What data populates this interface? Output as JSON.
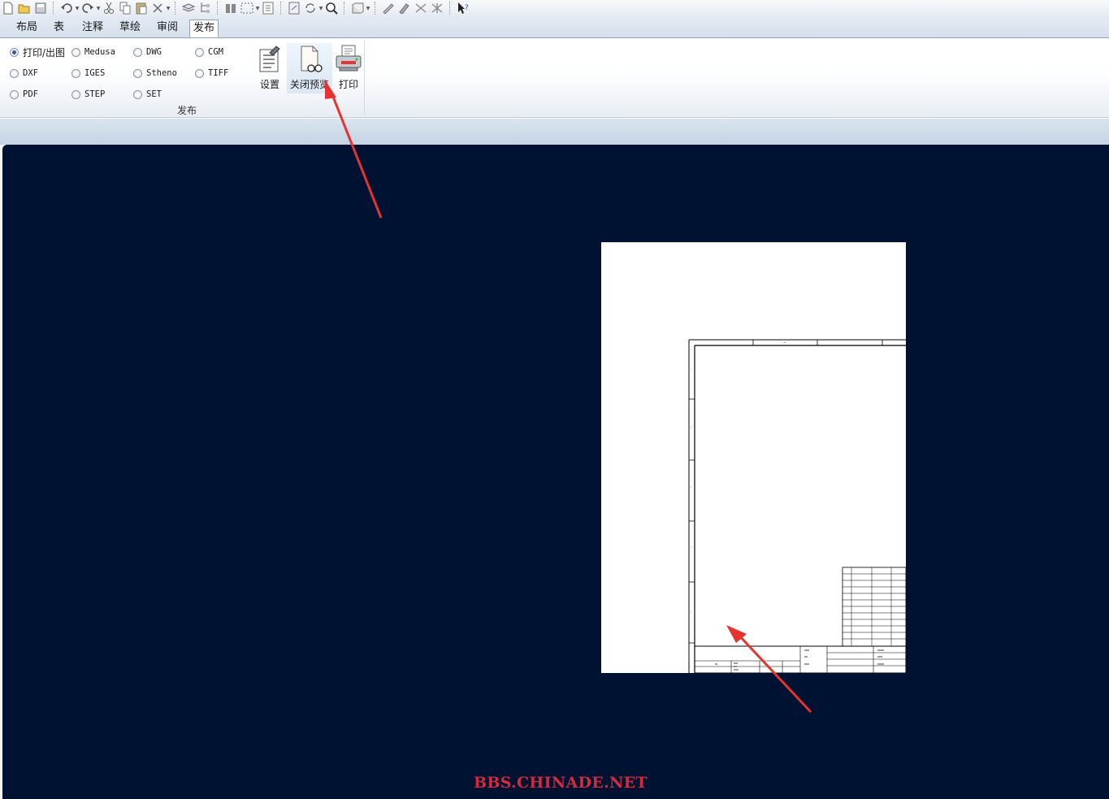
{
  "tabs": [
    {
      "label": "布局",
      "active": false
    },
    {
      "label": "表",
      "active": false
    },
    {
      "label": "注释",
      "active": false
    },
    {
      "label": "草绘",
      "active": false
    },
    {
      "label": "审阅",
      "active": false
    },
    {
      "label": "发布",
      "active": true
    }
  ],
  "quick_access_icons": [
    "new-file-icon",
    "open-folder-icon",
    "save-icon",
    "undo-icon",
    "redo-icon",
    "cut-icon",
    "copy-icon",
    "paste-icon",
    "delete-icon",
    "layers-icon",
    "tree-icon",
    "find-icon",
    "select-box-icon",
    "properties-icon",
    "regenerate-icon",
    "refresh-icon",
    "zoom-icon",
    "display-style-icon",
    "sketch-tool-icon",
    "pencil-tool-icon",
    "erase-tool-icon",
    "erase-all-icon",
    "context-help-icon"
  ],
  "publish": {
    "formats": [
      {
        "label": "打印/出图",
        "selected": true
      },
      {
        "label": "Medusa",
        "selected": false
      },
      {
        "label": "DWG",
        "selected": false
      },
      {
        "label": "CGM",
        "selected": false
      },
      {
        "label": "DXF",
        "selected": false
      },
      {
        "label": "IGES",
        "selected": false
      },
      {
        "label": "Stheno",
        "selected": false
      },
      {
        "label": "TIFF",
        "selected": false
      },
      {
        "label": "PDF",
        "selected": false
      },
      {
        "label": "STEP",
        "selected": false
      },
      {
        "label": "SET",
        "selected": false
      }
    ],
    "buttons": {
      "settings": "设置",
      "close_preview": "关闭预览",
      "print": "打印"
    },
    "group_label": "发布"
  },
  "watermark": "BBS.CHINADE.NET",
  "colors": {
    "canvas_background": "#001231",
    "arrow": "#e8322e",
    "watermark": "#d32a3e",
    "active_radio": "#2a5fa8"
  }
}
